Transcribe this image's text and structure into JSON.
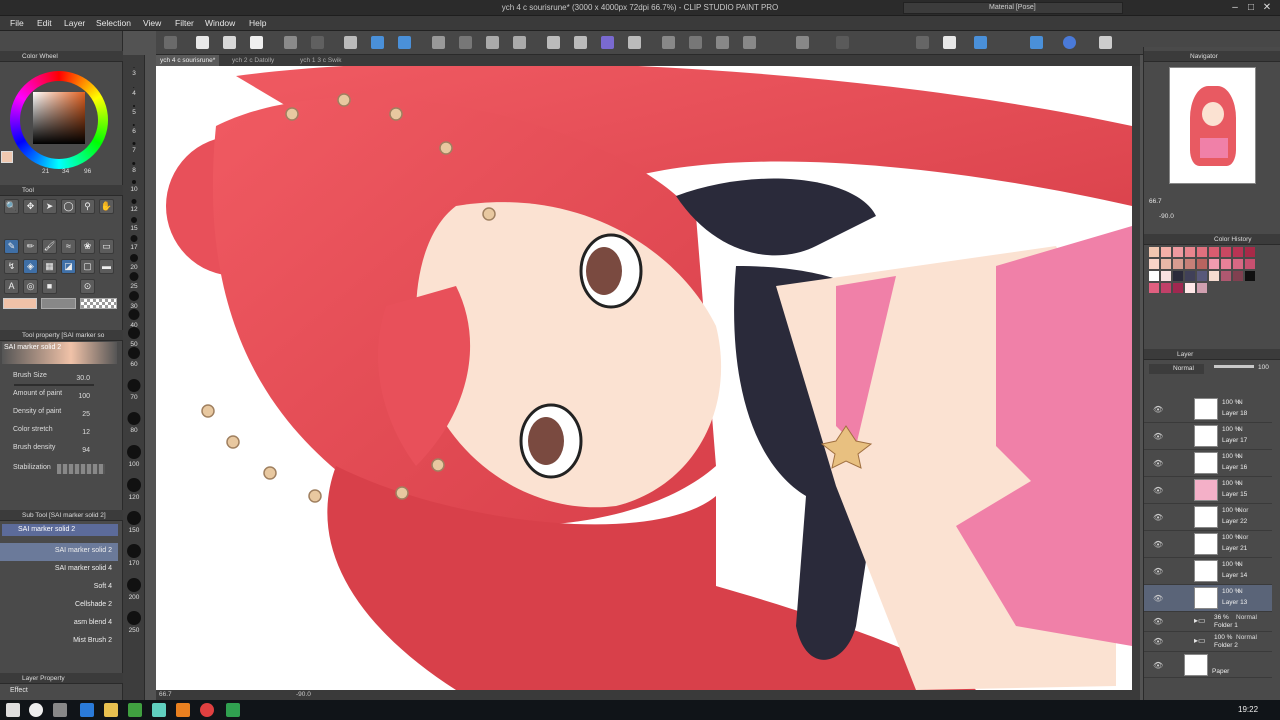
{
  "app": {
    "title": "ych 4 c sourisrune* (3000 x 4000px 72dpi 66.7%) - CLIP STUDIO PAINT PRO",
    "material_field": "Material [Pose]"
  },
  "menu": [
    "File",
    "Edit",
    "Layer",
    "Selection",
    "View",
    "Filter",
    "Window",
    "Help"
  ],
  "doc_tabs": [
    "ych 4 c sourisrune*",
    "ych 2 c Datolly",
    "ych 1 3 c Swik"
  ],
  "left": {
    "color_wheel_title": "Color Wheel",
    "color_values": {
      "a": "21",
      "b": "34",
      "c": "96"
    },
    "tool_title": "Tool",
    "tool_property_title": "Tool property [SAI marker so",
    "tool_preset": "SAI marker solid 2",
    "props": [
      {
        "label": "Brush Size",
        "value": "30.0"
      },
      {
        "label": "Amount of paint",
        "value": "100"
      },
      {
        "label": "Density of paint",
        "value": "25"
      },
      {
        "label": "Color stretch",
        "value": "12"
      },
      {
        "label": "Brush density",
        "value": "94"
      },
      {
        "label": "Stabilization",
        "value": ""
      }
    ],
    "subtool_title": "Sub Tool [SAI marker solid 2]",
    "subtool_group": "SAI marker solid 2",
    "brushes": [
      "SAI marker solid 2",
      "SAI marker solid 4",
      "Soft 4",
      "Cellshade 2",
      "asm blend 4",
      "Mist Brush 2"
    ],
    "layer_property_title": "Layer Property",
    "effect_label": "Effect"
  },
  "ruler": [
    "3",
    "4",
    "5",
    "6",
    "7",
    "8",
    "10",
    "12",
    "15",
    "17",
    "20",
    "25",
    "30",
    "40",
    "50",
    "60",
    "70",
    "80",
    "100",
    "120",
    "150",
    "170",
    "200",
    "250"
  ],
  "status": {
    "zoom": "66.7",
    "angle": "-90.0"
  },
  "right": {
    "navigator_title": "Navigator",
    "nav_zoom": "66.7",
    "nav_angle": "-90.0",
    "color_history_title": "Color History",
    "layer_title": "Layer",
    "blend_mode": "Normal",
    "opacity": "100",
    "layers": [
      {
        "pct": "100 %",
        "mode": "N",
        "name": "Layer 18"
      },
      {
        "pct": "100 %",
        "mode": "N",
        "name": "Layer 17"
      },
      {
        "pct": "100 %",
        "mode": "N",
        "name": "Layer 16"
      },
      {
        "pct": "100 %",
        "mode": "N",
        "name": "Layer 15"
      },
      {
        "pct": "100 %",
        "mode": "Nor",
        "name": "Layer 22"
      },
      {
        "pct": "100 %",
        "mode": "Nor",
        "name": "Layer 21"
      },
      {
        "pct": "100 %",
        "mode": "N",
        "name": "Layer 14"
      },
      {
        "pct": "100 %",
        "mode": "N",
        "name": "Layer 13"
      }
    ],
    "folders": [
      {
        "pct": "36 %",
        "mode": "Normal",
        "name": "Folder 1"
      },
      {
        "pct": "100 %",
        "mode": "Normal",
        "name": "Folder 2"
      }
    ],
    "paper": "Paper",
    "swatches": [
      "#f0c6b0",
      "#f4b0a8",
      "#ee9aa0",
      "#e8858e",
      "#e0707e",
      "#d85c70",
      "#c84862",
      "#b83454",
      "#a82a48",
      "#f8d4c8",
      "#e8b8a8",
      "#d89c90",
      "#c88078",
      "#b86460",
      "#f09ab0",
      "#e88098",
      "#d86884",
      "#c85070",
      "#ffffff",
      "#f8e0e0",
      "#2a2a3a",
      "#404058",
      "#58587a",
      "#f6dcd0",
      "#b05870",
      "#804050",
      "#101010",
      "#e06080",
      "#c04068",
      "#a02850",
      "#ffe8e8",
      "#d0a0b0"
    ]
  },
  "taskbar": {
    "clock": "19:22"
  }
}
